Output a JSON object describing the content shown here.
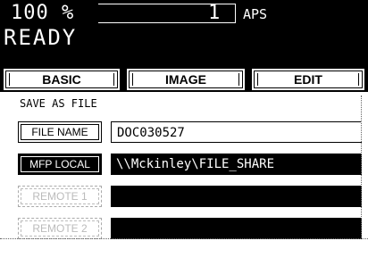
{
  "status": {
    "zoom": "100 %",
    "quantity": "1",
    "paper_mode": "APS",
    "message": "READY"
  },
  "tabs": [
    {
      "label": "BASIC"
    },
    {
      "label": "IMAGE"
    },
    {
      "label": "EDIT"
    }
  ],
  "section": {
    "title": "SAVE AS FILE"
  },
  "rows": [
    {
      "button": "FILE NAME",
      "value": "DOC030527"
    },
    {
      "button": "MFP LOCAL",
      "value": "\\\\Mckinley\\FILE_SHARE"
    },
    {
      "button": "REMOTE 1",
      "value": ""
    },
    {
      "button": "REMOTE 2",
      "value": ""
    }
  ]
}
